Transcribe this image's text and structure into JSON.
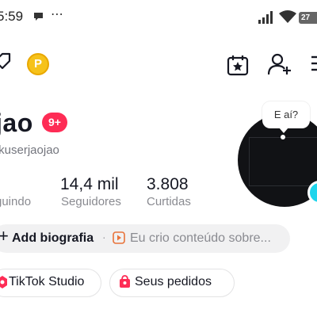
{
  "status_bar": {
    "time": "5:59",
    "more_indicator": "⋯",
    "battery_level": "27"
  },
  "profile": {
    "display_name": "jao",
    "notification_badge": "9+",
    "username": "tkuserjaojao",
    "avatar_bubble_text": "E aí?"
  },
  "stats": [
    {
      "value": "",
      "label": "guindo"
    },
    {
      "value": "14,4 mil",
      "label": "Seguidores"
    },
    {
      "value": "3.808",
      "label": "Curtidas"
    }
  ],
  "bio": {
    "add_label": "Add biografia",
    "separator": "·",
    "hint": "Eu crio conteúdo sobre..."
  },
  "actions": [
    {
      "label": "TikTok Studio",
      "icon": "tiktok-studio-icon"
    },
    {
      "label": "Seus pedidos",
      "icon": "shopping-bag-icon"
    }
  ],
  "colors": {
    "badge": "#fe2c55",
    "coin": "#f6c21a",
    "avatar_plus": "#20d5ec",
    "chip_icon": "#fe2c55"
  },
  "icons": {
    "top_left": "tag-icon",
    "coin": "coin-icon",
    "coin_letter": "P",
    "calendar": "calendar-star-icon",
    "add_user": "add-user-icon",
    "menu": "menu-icon"
  }
}
